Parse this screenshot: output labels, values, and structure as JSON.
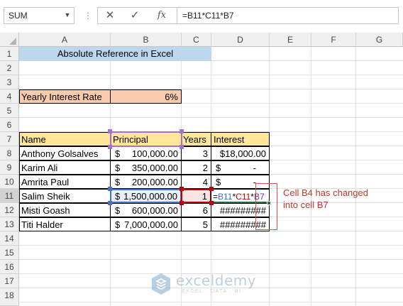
{
  "formula_bar": {
    "name_box": "SUM",
    "cancel_icon": "✕",
    "enter_icon": "✓",
    "function_icon": "fx",
    "formula": "=B11*C11*B7"
  },
  "columns": [
    "A",
    "B",
    "C",
    "D",
    "E",
    "F",
    "G"
  ],
  "rows": [
    "1",
    "2",
    "3",
    "4",
    "5",
    "6",
    "7",
    "8",
    "9",
    "10",
    "11",
    "12",
    "13",
    "14",
    "15",
    "16",
    "17",
    "18"
  ],
  "title": "Absolute Reference in Excel",
  "rate": {
    "label": "Yearly Interest Rate",
    "value": "6%"
  },
  "table": {
    "headers": [
      "Name",
      "Principal",
      "Years",
      "Interest"
    ],
    "rows": [
      {
        "name": "Anthony Golsalves",
        "cur": "$",
        "principal": "100,000.00",
        "years": "3",
        "interest": "$18,000.00"
      },
      {
        "name": "Karim Ali",
        "cur": "$",
        "principal": "350,000.00",
        "years": "2",
        "interest_cur": "$",
        "interest": "-"
      },
      {
        "name": "Amrita Paul",
        "cur": "$",
        "principal": "200,000.00",
        "years": "4",
        "interest_cur": "$",
        "interest": "-"
      },
      {
        "name": "Salim Sheik",
        "cur": "$",
        "principal": "1,500,000.00",
        "years": "1"
      },
      {
        "name": "Misti Goash",
        "cur": "$",
        "principal": "600,000.00",
        "years": "6",
        "interest": "#########"
      },
      {
        "name": "Titi Halder",
        "cur": "$",
        "principal": "7,000,000.00",
        "years": "5",
        "interest": "#########"
      }
    ],
    "editing_formula": {
      "eq": "=",
      "ref1": "B11",
      "op1": "*",
      "ref2": "C11",
      "op2": "*",
      "ref3": "B7"
    }
  },
  "annotation": "Cell B4 has changed into cell B7",
  "watermark": {
    "name": "exceldemy",
    "tagline": "EXCEL · DATA · BI"
  },
  "colors": {
    "title_fill": "#bdd7ee",
    "rate_fill": "#f8cbad",
    "header_fill": "#ffe699",
    "ref1": "#4472c4",
    "ref2": "#c00000",
    "ref3": "#7030a0",
    "annotation": "#c0392b"
  }
}
